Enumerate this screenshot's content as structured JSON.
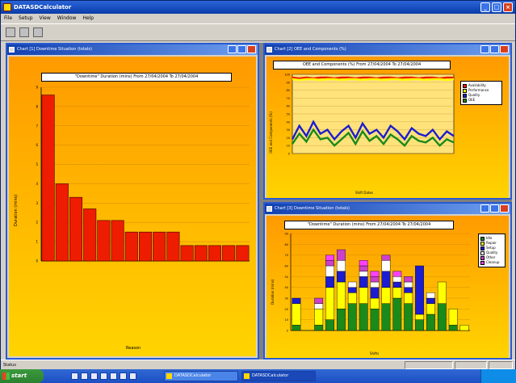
{
  "window": {
    "title": "DATASDCalculator"
  },
  "menu": [
    "File",
    "Setup",
    "View",
    "Window",
    "Help"
  ],
  "toolbar": {
    "icons": [
      "open-icon",
      "save-icon",
      "print-icon"
    ]
  },
  "chart1": {
    "window_title": "Chart [1] Downtime Situation (totals)",
    "chart_data": {
      "type": "bar",
      "title": "\"Downtime\" Duration (mins) From 27/04/2004 To 27/04/2004",
      "ylabel": "Duration (mins)",
      "xlabel": "Reason",
      "ylim": [
        0,
        9
      ],
      "grid": true,
      "color": "#ee1c00",
      "values": [
        8.6,
        4.0,
        3.3,
        2.7,
        2.1,
        2.1,
        1.5,
        1.5,
        1.5,
        1.5,
        0.8,
        0.8,
        0.8,
        0.8,
        0.8
      ]
    }
  },
  "chart2": {
    "window_title": "Chart [2] OEE and Components (%)",
    "chart_data": {
      "type": "line",
      "title": "OEE and Components (%) From 27/04/2004 To 27/04/2004",
      "ylabel": "OEE and Components (%)",
      "xlabel": "Shift Dates",
      "ylim": [
        0,
        100
      ],
      "grid": true,
      "legend_position": "right",
      "series": [
        {
          "name": "Availability",
          "color": "#ee1c00",
          "values": [
            96,
            95,
            96,
            95,
            96,
            96,
            95,
            96,
            96,
            95,
            96,
            96,
            95,
            96,
            96,
            95,
            96,
            96,
            95,
            96,
            96,
            95,
            96,
            96
          ]
        },
        {
          "name": "Performance",
          "color": "#ffff00",
          "values": [
            94,
            93,
            94,
            94,
            93,
            94,
            94,
            93,
            94,
            94,
            93,
            94,
            94,
            93,
            94,
            94,
            93,
            94,
            94,
            93,
            94,
            94,
            93,
            94
          ]
        },
        {
          "name": "Quality",
          "color": "#1c1cd0",
          "values": [
            18,
            35,
            22,
            40,
            25,
            30,
            18,
            28,
            35,
            20,
            38,
            25,
            30,
            20,
            35,
            28,
            18,
            32,
            25,
            22,
            30,
            18,
            28,
            22
          ]
        },
        {
          "name": "OEE",
          "color": "#1a8a1a",
          "values": [
            12,
            25,
            15,
            30,
            18,
            20,
            10,
            18,
            26,
            12,
            28,
            16,
            22,
            12,
            24,
            18,
            10,
            22,
            16,
            14,
            20,
            10,
            18,
            14
          ]
        }
      ]
    }
  },
  "chart3": {
    "window_title": "Chart [3] Downtime Situation (totals)",
    "chart_data": {
      "type": "bar",
      "title": "\"Downtime\" Duration (mins) From 27/04/2004 To 27/04/2004",
      "ylabel": "Duration (mins)",
      "xlabel": "Shifts",
      "ylim": [
        0,
        90
      ],
      "grid": true,
      "legend_position": "right",
      "series": [
        {
          "name": "Idle",
          "color": "#1a8a1a",
          "values": [
            5,
            0,
            5,
            10,
            20,
            25,
            25,
            20,
            25,
            30,
            25,
            10,
            15,
            25,
            5,
            0
          ]
        },
        {
          "name": "Repair",
          "color": "#ffff00",
          "values": [
            20,
            0,
            15,
            30,
            25,
            10,
            15,
            10,
            15,
            10,
            10,
            5,
            10,
            20,
            15,
            5
          ]
        },
        {
          "name": "Setup",
          "color": "#1c1cd0",
          "values": [
            5,
            0,
            0,
            10,
            10,
            5,
            10,
            10,
            15,
            5,
            5,
            45,
            5,
            0,
            0,
            0
          ]
        },
        {
          "name": "Quality",
          "color": "#ffffff",
          "values": [
            0,
            0,
            5,
            10,
            10,
            5,
            5,
            5,
            10,
            5,
            5,
            0,
            5,
            0,
            0,
            0
          ]
        },
        {
          "name": "Other",
          "color": "#cc40cc",
          "values": [
            0,
            0,
            5,
            5,
            10,
            0,
            5,
            5,
            5,
            0,
            5,
            0,
            0,
            0,
            0,
            0
          ]
        },
        {
          "name": "Cleanup",
          "color": "#ff40ff",
          "values": [
            0,
            0,
            0,
            5,
            0,
            0,
            5,
            5,
            0,
            5,
            0,
            0,
            0,
            0,
            0,
            0
          ]
        }
      ]
    }
  },
  "statusbar": {
    "text": "Status"
  },
  "taskbar": {
    "start": "start",
    "tasks": [
      "DATASDCalculator",
      "DATASDCalculator"
    ]
  }
}
